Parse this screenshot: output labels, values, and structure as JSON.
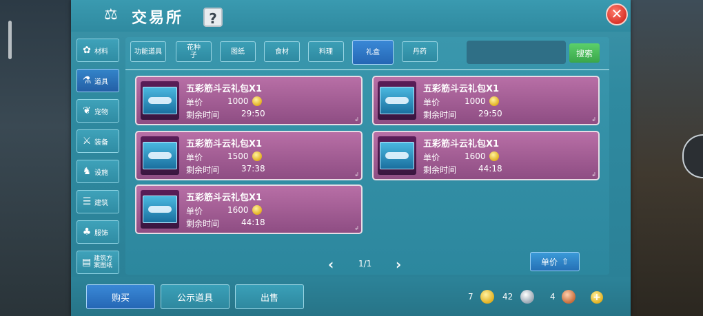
{
  "app": {
    "title": "交易所"
  },
  "categories": [
    {
      "label": "材料",
      "icon": "flower-icon"
    },
    {
      "label": "道具",
      "icon": "flask-icon"
    },
    {
      "label": "宠物",
      "icon": "paw-icon"
    },
    {
      "label": "装备",
      "icon": "sword-icon"
    },
    {
      "label": "设施",
      "icon": "horse-icon"
    },
    {
      "label": "建筑",
      "icon": "building-icon"
    },
    {
      "label": "服饰",
      "icon": "clothes-icon"
    },
    {
      "label": "建筑方案图纸",
      "icon": "blueprint-icon"
    }
  ],
  "active_category": "道具",
  "tabs": [
    "功能道具",
    "花种子",
    "图纸",
    "食材",
    "料理",
    "礼盒",
    "丹药"
  ],
  "active_tab": "礼盒",
  "search": {
    "button_label": "搜索",
    "value": ""
  },
  "listing_labels": {
    "price": "单价",
    "remaining": "剩余时间"
  },
  "listings": [
    {
      "name": "五彩筋斗云礼包X1",
      "price": "1000",
      "time": "29:50"
    },
    {
      "name": "五彩筋斗云礼包X1",
      "price": "1000",
      "time": "29:50"
    },
    {
      "name": "五彩筋斗云礼包X1",
      "price": "1500",
      "time": "37:38"
    },
    {
      "name": "五彩筋斗云礼包X1",
      "price": "1600",
      "time": "44:18"
    },
    {
      "name": "五彩筋斗云礼包X1",
      "price": "1600",
      "time": "44:18"
    }
  ],
  "pagination": {
    "text": "1/1"
  },
  "sort": {
    "label": "单价"
  },
  "bottom_buttons": {
    "buy": "购买",
    "public": "公示道具",
    "sell": "出售"
  },
  "currency": {
    "gold": "7",
    "silver": "42",
    "bronze": "4"
  },
  "colors": {
    "panel": "#2f8aa0",
    "card": "#a25d95",
    "active": "#2b70c0",
    "search": "#45b955",
    "close": "#d9342a"
  }
}
